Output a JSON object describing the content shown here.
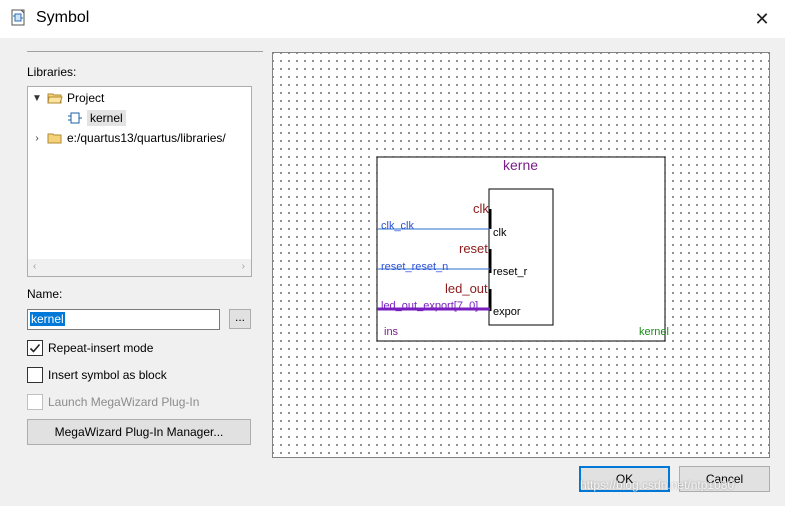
{
  "window": {
    "title": "Symbol",
    "icon": "symbol-editor-icon"
  },
  "libraries": {
    "label": "Libraries:",
    "tree": [
      {
        "label": "Project",
        "expanded": true,
        "icon": "folder-open-icon"
      },
      {
        "label": "kernel",
        "selected": true,
        "icon": "symbol-icon"
      },
      {
        "label": "e:/quartus13/quartus/libraries/",
        "expanded": false,
        "icon": "folder-icon"
      }
    ]
  },
  "name": {
    "label": "Name:",
    "value": "kernel",
    "browse_label": "..."
  },
  "options": {
    "repeat_insert": {
      "label": "Repeat-insert mode",
      "checked": true
    },
    "insert_block": {
      "label": "Insert symbol as block",
      "checked": false
    },
    "launch_megawizard": {
      "label": "Launch MegaWizard Plug-In",
      "checked": false,
      "disabled": true
    }
  },
  "megawizard_button": "MegaWizard Plug-In Manager...",
  "preview": {
    "symbol_title": "kerne",
    "instance_label": "ins",
    "library_label": "kernel",
    "ports": [
      {
        "name_outer": "clk",
        "signal": "clk_clk",
        "pin": "clk"
      },
      {
        "name_outer": "reset",
        "signal": "reset_reset_n",
        "pin": "reset_r"
      },
      {
        "name_outer": "led_out",
        "signal": "led_out_export[7..0]",
        "pin": "expor"
      }
    ]
  },
  "buttons": {
    "ok": "OK",
    "cancel": "Cancel"
  },
  "watermark": "https://blog.csdn.net/ntp1080"
}
